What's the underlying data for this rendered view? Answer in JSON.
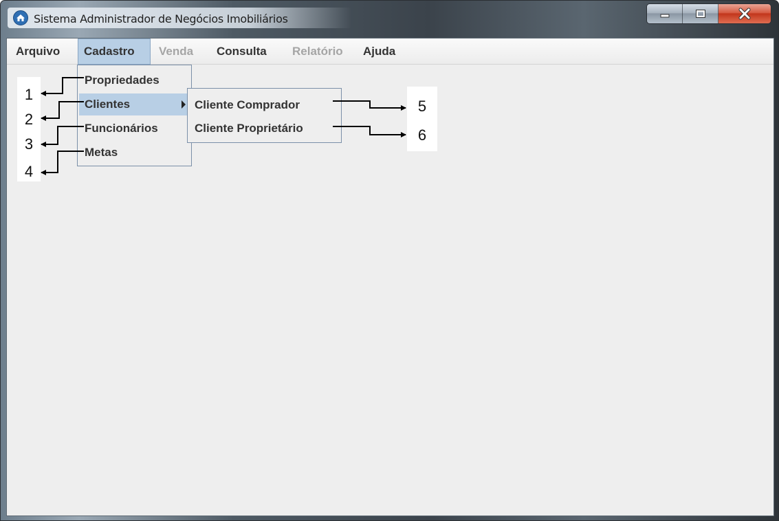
{
  "window": {
    "title": "Sistema Administrador de Negócios Imobiliários",
    "app_icon": "house-icon",
    "controls": [
      "minimize-icon",
      "maximize-icon",
      "close-icon"
    ]
  },
  "menubar": {
    "items": [
      {
        "label": "Arquivo",
        "enabled": true
      },
      {
        "label": "Cadastro",
        "enabled": true,
        "open": true
      },
      {
        "label": "Venda",
        "enabled": false
      },
      {
        "label": "Consulta",
        "enabled": true
      },
      {
        "label": "Relatório",
        "enabled": false
      },
      {
        "label": "Ajuda",
        "enabled": true
      }
    ]
  },
  "cadastro_menu": {
    "items": [
      {
        "label": "Propriedades"
      },
      {
        "label": "Clientes",
        "has_submenu": true,
        "selected": true
      },
      {
        "label": "Funcionários"
      },
      {
        "label": "Metas"
      }
    ]
  },
  "clientes_submenu": {
    "items": [
      {
        "label": "Cliente Comprador"
      },
      {
        "label": "Cliente Proprietário"
      }
    ]
  },
  "annotations": {
    "labels": [
      "1",
      "2",
      "3",
      "4",
      "5",
      "6"
    ]
  },
  "colors": {
    "selection": "#b8cfe5",
    "disabled_text": "#a5a5a5",
    "client_bg": "#eeeeee"
  }
}
